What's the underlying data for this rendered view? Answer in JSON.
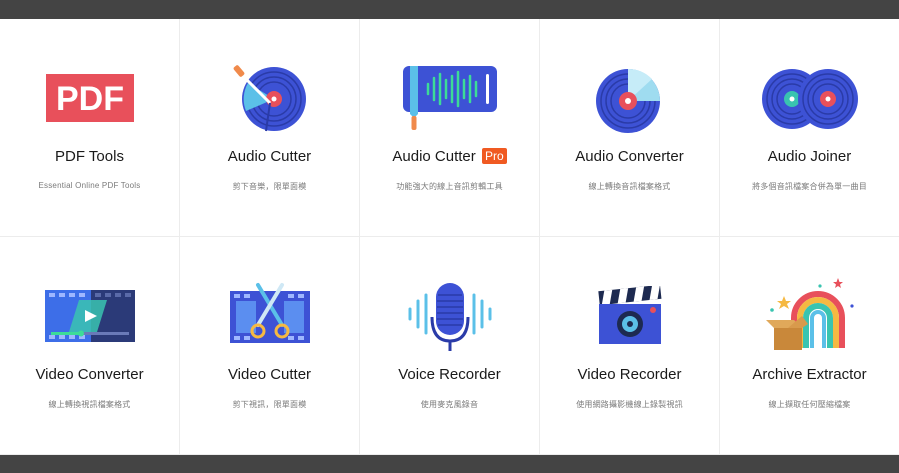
{
  "tools": [
    {
      "title": "PDF Tools",
      "description": "Essential Online PDF Tools",
      "icon": "pdf-icon",
      "icon_text": "PDF"
    },
    {
      "title": "Audio Cutter",
      "description": "剪下音樂，限單面模",
      "icon": "vinyl-knife-icon"
    },
    {
      "title": "Audio Cutter",
      "badge": "Pro",
      "description": "功能強大的線上音訊剪輯工具",
      "icon": "waveform-knife-icon"
    },
    {
      "title": "Audio Converter",
      "description": "線上轉換音訊檔案格式",
      "icon": "vinyl-cd-icon"
    },
    {
      "title": "Audio Joiner",
      "description": "將多個音訊檔案合併為單一曲目",
      "icon": "two-vinyls-icon"
    },
    {
      "title": "Video Converter",
      "description": "線上轉換視訊檔案格式",
      "icon": "film-play-icon"
    },
    {
      "title": "Video Cutter",
      "description": "剪下視訊，限單面模",
      "icon": "film-scissors-icon"
    },
    {
      "title": "Voice Recorder",
      "description": "使用麥克風錄音",
      "icon": "microphone-icon"
    },
    {
      "title": "Video Recorder",
      "description": "使用網路攝影機線上錄製視訊",
      "icon": "clapperboard-camera-icon"
    },
    {
      "title": "Archive Extractor",
      "description": "線上擷取任何壓縮檔案",
      "icon": "box-rainbow-icon"
    }
  ],
  "colors": {
    "accent_blue": "#3d52d5",
    "accent_red": "#e8505b",
    "badge_orange": "#f05a22",
    "teal": "#39c4b0"
  }
}
